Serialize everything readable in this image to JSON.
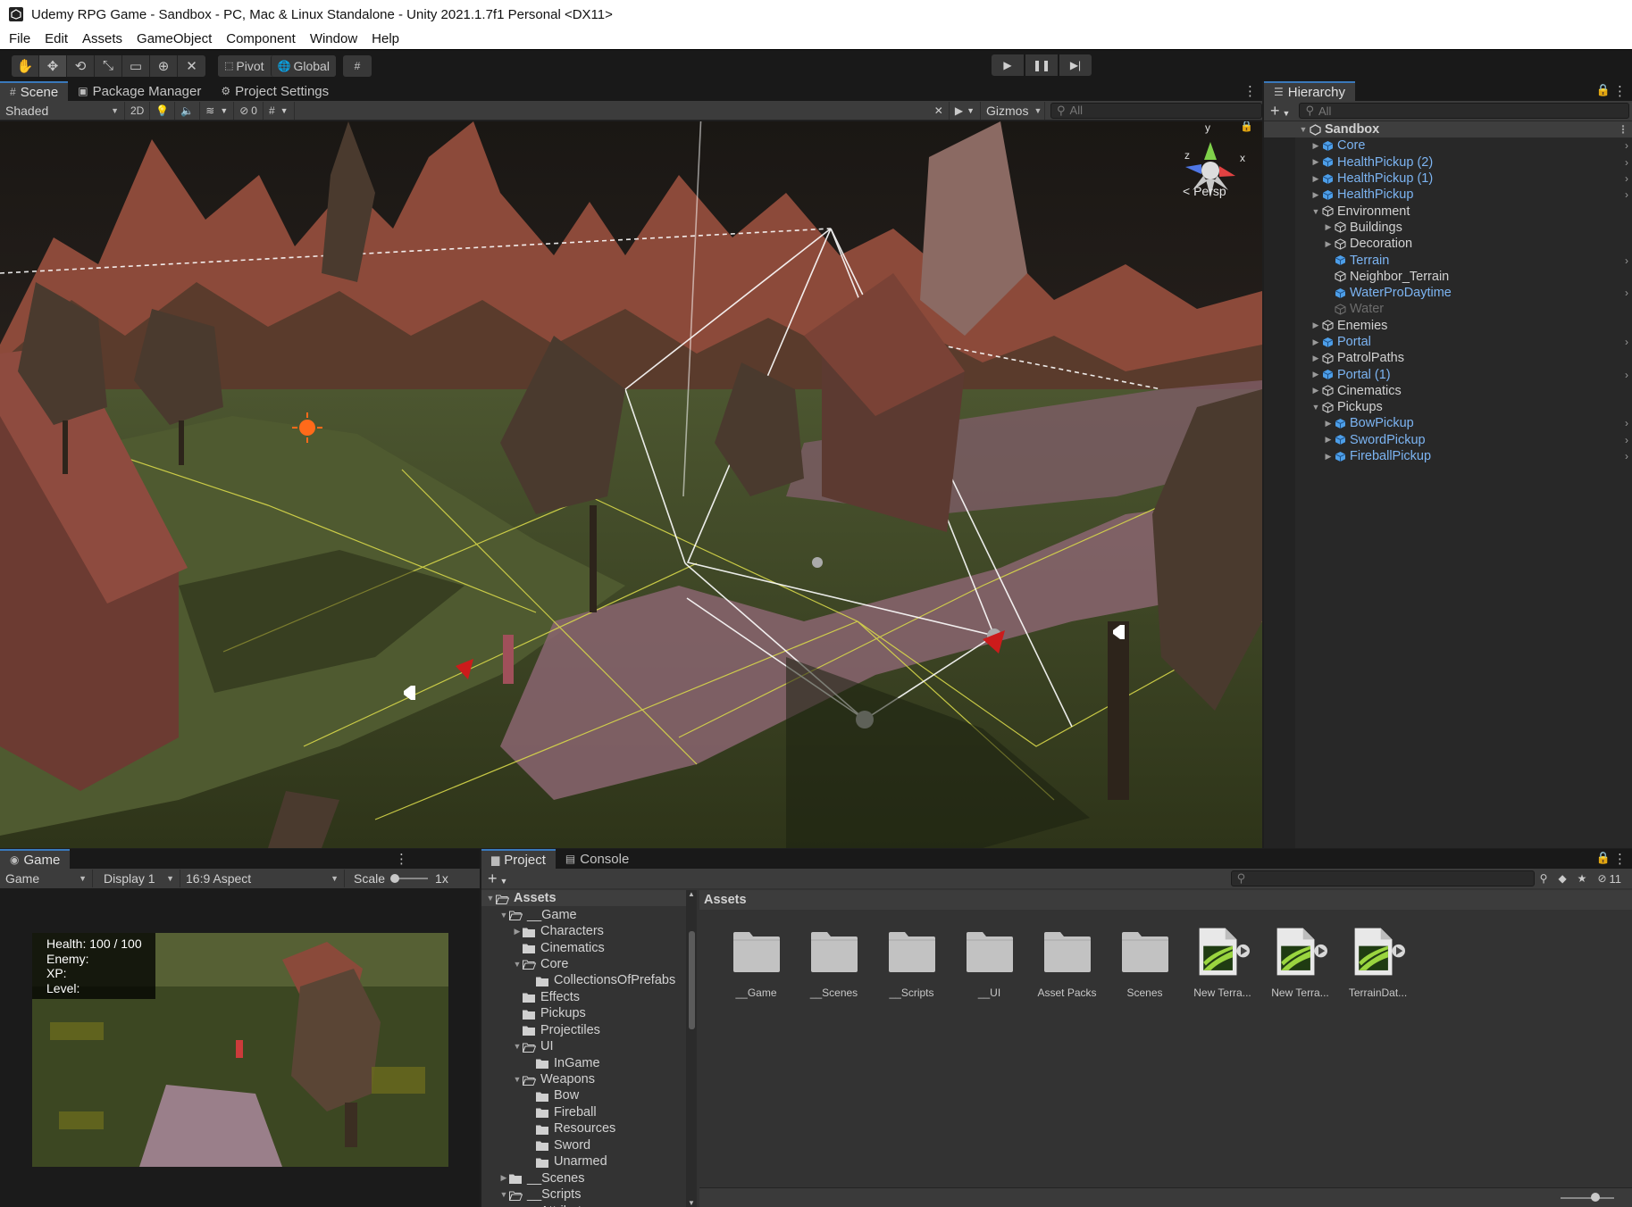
{
  "window": {
    "title": "Udemy RPG Game - Sandbox - PC, Mac & Linux Standalone - Unity 2021.1.7f1 Personal <DX11>"
  },
  "menu": [
    "File",
    "Edit",
    "Assets",
    "GameObject",
    "Component",
    "Window",
    "Help"
  ],
  "toolbar": {
    "tools": [
      "hand-tool-icon",
      "move-tool-icon",
      "rotate-tool-icon",
      "scale-tool-icon",
      "rect-tool-icon",
      "transform-tool-icon",
      "custom-tool-icon"
    ],
    "pivot": "Pivot",
    "global": "Global"
  },
  "scene_tabs": {
    "scene": "Scene",
    "package_manager": "Package Manager",
    "project_settings": "Project Settings"
  },
  "scene_ctrl": {
    "shading_mode": "Shaded",
    "mode_2d": "2D",
    "hidden_count": "0",
    "gizmos": "Gizmos",
    "search_placeholder": "All"
  },
  "viewport": {
    "persp_label": "Persp",
    "axis_y": "y",
    "axis_x": "x",
    "axis_z": "z"
  },
  "hierarchy": {
    "title": "Hierarchy",
    "search_placeholder": "All",
    "root": "Sandbox",
    "items": [
      {
        "label": "Core"
      },
      {
        "label": "HealthPickup (2)"
      },
      {
        "label": "HealthPickup (1)"
      },
      {
        "label": "HealthPickup"
      },
      {
        "label": "Environment"
      },
      {
        "label": "Buildings"
      },
      {
        "label": "Decoration"
      },
      {
        "label": "Terrain"
      },
      {
        "label": "Neighbor_Terrain"
      },
      {
        "label": "WaterProDaytime"
      },
      {
        "label": "Water"
      },
      {
        "label": "Enemies"
      },
      {
        "label": "Portal"
      },
      {
        "label": "PatrolPaths"
      },
      {
        "label": "Portal (1)"
      },
      {
        "label": "Cinematics"
      },
      {
        "label": "Pickups"
      },
      {
        "label": "BowPickup"
      },
      {
        "label": "SwordPickup"
      },
      {
        "label": "FireballPickup"
      }
    ]
  },
  "game": {
    "tab": "Game",
    "mode": "Game",
    "display": "Display 1",
    "aspect": "16:9 Aspect",
    "scale_label": "Scale",
    "scale_value": "1x",
    "hud": {
      "health": "Health:  100 / 100",
      "enemy": "Enemy:",
      "xp": "XP:",
      "level": "Level:"
    }
  },
  "project": {
    "tab_project": "Project",
    "tab_console": "Console",
    "hidden_count": "11",
    "tree": [
      {
        "label": "Assets"
      },
      {
        "label": "__Game"
      },
      {
        "label": "Characters"
      },
      {
        "label": "Cinematics"
      },
      {
        "label": "Core"
      },
      {
        "label": "CollectionsOfPrefabs"
      },
      {
        "label": "Effects"
      },
      {
        "label": "Pickups"
      },
      {
        "label": "Projectiles"
      },
      {
        "label": "UI"
      },
      {
        "label": "InGame"
      },
      {
        "label": "Weapons"
      },
      {
        "label": "Bow"
      },
      {
        "label": "Fireball"
      },
      {
        "label": "Resources"
      },
      {
        "label": "Sword"
      },
      {
        "label": "Unarmed"
      },
      {
        "label": "__Scenes"
      },
      {
        "label": "__Scripts"
      },
      {
        "label": "Attributes"
      }
    ],
    "breadcrumb": "Assets",
    "assets": [
      {
        "label": "__Game"
      },
      {
        "label": "__Scenes"
      },
      {
        "label": "__Scripts"
      },
      {
        "label": "__UI"
      },
      {
        "label": "Asset Packs"
      },
      {
        "label": "Scenes"
      },
      {
        "label": "New Terra..."
      },
      {
        "label": "New Terra..."
      },
      {
        "label": "TerrainDat..."
      }
    ]
  },
  "colors": {
    "accent": "#3a79bb",
    "prefab": "#7cb4f2",
    "terrain_asset": "#9ad53f"
  }
}
